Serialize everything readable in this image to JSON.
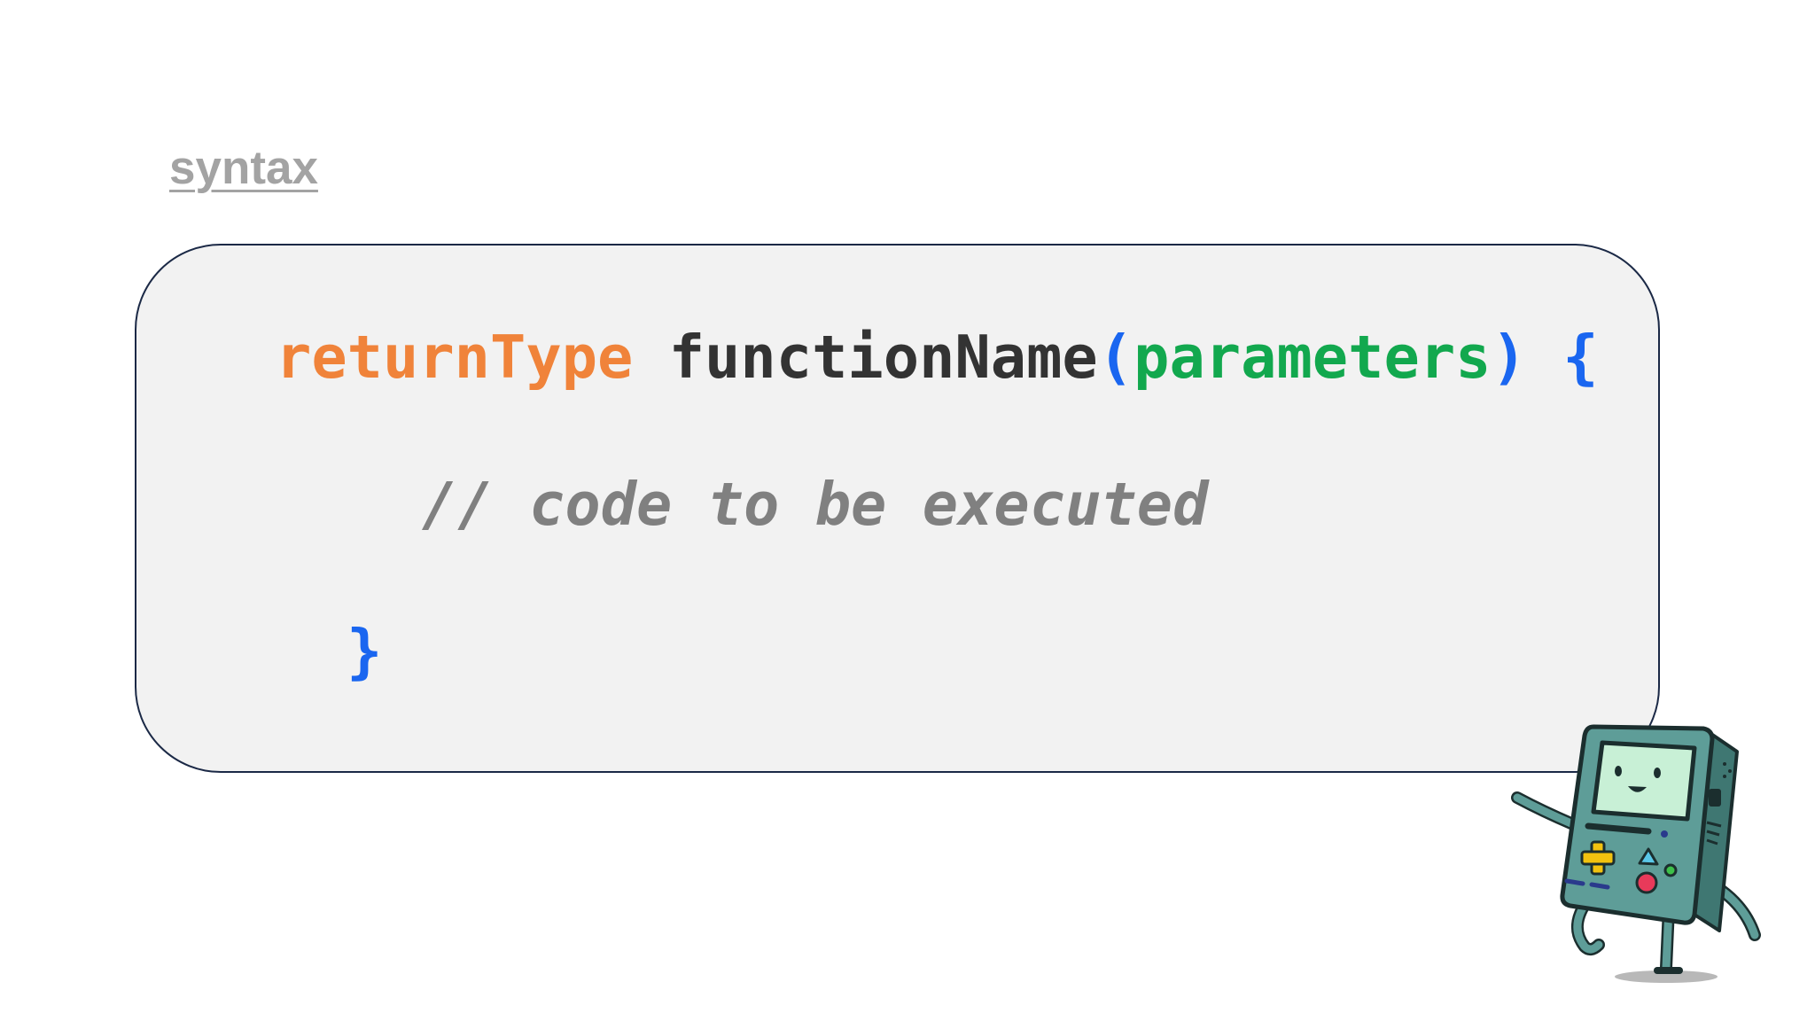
{
  "slide": {
    "heading": "syntax"
  },
  "code": {
    "line1": {
      "return_type": "returnType",
      "function_name": "functionName",
      "open_paren": "(",
      "parameters": "parameters",
      "close_paren": ")",
      "open_brace": "{"
    },
    "line2": {
      "comment": "// code to be executed"
    },
    "line3": {
      "close_brace": "}"
    }
  },
  "colors": {
    "return_type": "#f0833a",
    "function_name": "#333333",
    "punctuation": "#1a66f0",
    "parameters": "#12a84e",
    "comment": "#808080",
    "heading": "#a3a3a3",
    "card_background": "#f2f2f2",
    "card_border": "#1b2946"
  },
  "mascot": {
    "icon": "handheld-game-console-character-icon"
  }
}
